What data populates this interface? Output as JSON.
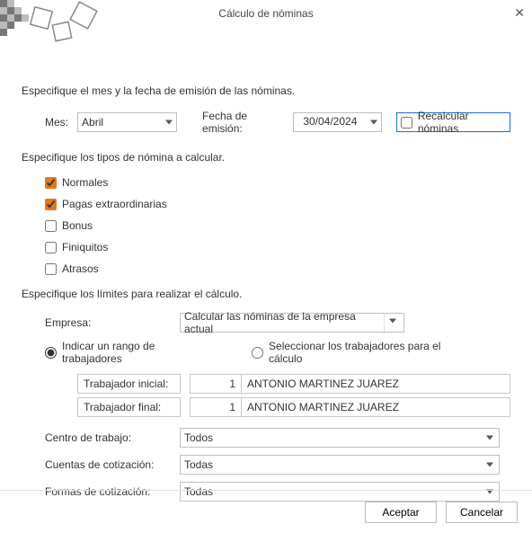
{
  "title": "Cálculo de nóminas",
  "section1": "Especifique el mes y la fecha de emisión de las nóminas.",
  "mes_label": "Mes:",
  "mes_value": "Abril",
  "fecha_label": "Fecha de emisión:",
  "fecha_value": "30/04/2024",
  "recalc_label": "Recalcular nóminas",
  "section2": "Especifique los tipos de nómina a calcular.",
  "tipos": [
    {
      "label": "Normales",
      "checked": true
    },
    {
      "label": "Pagas extraordinarias",
      "checked": true
    },
    {
      "label": "Bonus",
      "checked": false
    },
    {
      "label": "Finiquitos",
      "checked": false
    },
    {
      "label": "Atrasos",
      "checked": false
    }
  ],
  "section3": "Especifique los límites para realizar el cálculo.",
  "empresa_label": "Empresa:",
  "empresa_value": "Calcular las nóminas de la empresa actual",
  "radio_rango": "Indicar un rango de trabajadores",
  "radio_select": "Seleccionar los trabajadores para el cálculo",
  "trab_inicial_label": "Trabajador inicial:",
  "trab_inicial_num": "1",
  "trab_inicial_name": "ANTONIO MARTINEZ JUAREZ",
  "trab_final_label": "Trabajador final:",
  "trab_final_num": "1",
  "trab_final_name": "ANTONIO MARTINEZ JUAREZ",
  "centro_label": "Centro de trabajo:",
  "centro_value": "Todos",
  "cuentas_label": "Cuentas de cotización:",
  "cuentas_value": "Todas",
  "formas_label": "Formas de cotización:",
  "formas_value": "Todas",
  "aceptar": "Aceptar",
  "cancelar": "Cancelar"
}
